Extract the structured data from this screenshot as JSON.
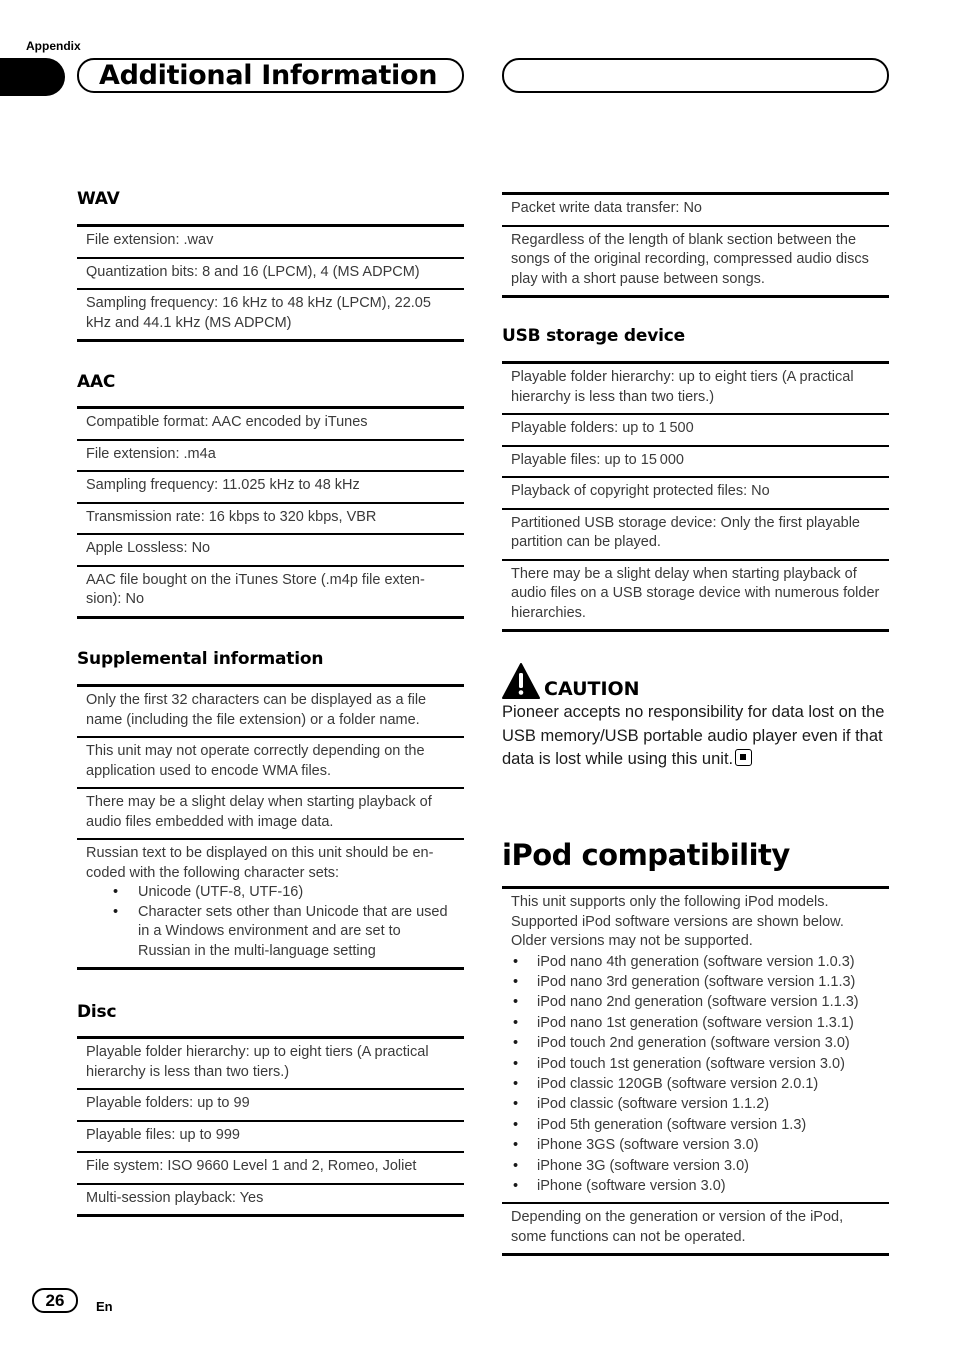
{
  "header": {
    "appendix_label": "Appendix",
    "title": "Additional Information"
  },
  "left_column": {
    "wav": {
      "heading": "WAV",
      "rows": [
        "File extension: .wav",
        "Quantization bits: 8 and 16 (LPCM), 4 (MS ADPCM)",
        "Sampling frequency: 16 kHz to 48 kHz (LPCM), 22.05 kHz and 44.1 kHz (MS ADPCM)"
      ]
    },
    "aac": {
      "heading": "AAC",
      "rows": [
        "Compatible format: AAC encoded by iTunes",
        "File extension: .m4a",
        "Sampling frequency: 11.025 kHz to 48 kHz",
        "Transmission rate: 16 kbps to 320 kbps, VBR",
        "Apple Lossless: No",
        "AAC file bought on the iTunes Store (.m4p file exten-sion): No"
      ]
    },
    "supplemental": {
      "heading": "Supplemental information",
      "rows": [
        "Only the first 32 characters can be displayed as a file name (including the file extension) or a folder name.",
        "This unit may not operate correctly depending on the application used to encode WMA files.",
        "There may be a slight delay when starting playback of audio files embedded with image data."
      ],
      "russian": {
        "intro": "Russian text to be displayed on this unit should be en-coded with the following character sets:",
        "bullets": [
          "Unicode (UTF-8, UTF-16)",
          "Character sets other than Unicode that are used in a Windows environment and are set to Russian in the multi-language setting"
        ]
      }
    },
    "disc": {
      "heading": "Disc",
      "rows": [
        "Playable folder hierarchy: up to eight tiers (A practical hierarchy is less than two tiers.)",
        "Playable folders: up to 99",
        "Playable files: up to 999",
        "File system: ISO 9660 Level 1 and 2, Romeo, Joliet",
        "Multi-session playback: Yes"
      ]
    }
  },
  "right_column": {
    "disc_continued": {
      "rows": [
        "Packet write data transfer: No",
        "Regardless of the length of blank section between the songs of the original recording, compressed audio discs play with a short pause between songs."
      ]
    },
    "usb": {
      "heading": "USB storage device",
      "rows": [
        "Playable folder hierarchy: up to eight tiers (A practical hierarchy is less than two tiers.)",
        "Playable folders: up to 1 500",
        "Playable files: up to 15 000",
        "Playback of copyright protected files: No",
        "Partitioned USB storage device: Only the first playable partition can be played.",
        "There may be a slight delay when starting playback of audio files on a USB storage device with numerous folder hierarchies."
      ]
    },
    "caution": {
      "icon": "warning-triangle-icon",
      "heading": "CAUTION",
      "body": "Pioneer accepts no responsibility for data lost on the USB memory/USB portable audio player even if that data is lost while using this unit."
    },
    "ipod": {
      "heading": "iPod compatibility",
      "intro": "This unit supports only the following iPod models. Supported iPod software versions are shown below. Older versions may not be supported.",
      "models": [
        "iPod nano 4th generation (software version 1.0.3)",
        "iPod nano 3rd generation (software version 1.1.3)",
        "iPod nano 2nd generation (software version 1.1.3)",
        "iPod nano 1st generation (software version 1.3.1)",
        "iPod touch 2nd generation (software version 3.0)",
        "iPod touch 1st generation (software version 3.0)",
        "iPod classic 120GB (software version 2.0.1)",
        "iPod classic (software version 1.1.2)",
        "iPod 5th generation (software version 1.3)",
        "iPhone 3GS (software version 3.0)",
        "iPhone 3G (software version 3.0)",
        "iPhone (software version 3.0)"
      ],
      "note": "Depending on the generation or version of the iPod, some functions can not be operated."
    }
  },
  "footer": {
    "page_number": "26",
    "language": "En"
  }
}
